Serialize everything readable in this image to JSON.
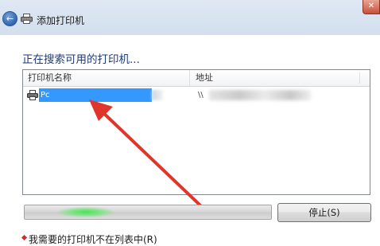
{
  "window": {
    "title": "添加打印机",
    "close_label": "✕"
  },
  "page": {
    "heading": "正在搜索可用的打印机..."
  },
  "printer_list": {
    "columns": [
      "打印机名称",
      "地址"
    ],
    "rows": [
      {
        "name": "Pc",
        "address": "\\\\"
      }
    ]
  },
  "progress": {
    "state": "indeterminate"
  },
  "buttons": {
    "stop_label": "停止(S)"
  },
  "bottom_link": {
    "text": "我需要的打印机不在列表中(R)"
  },
  "colors": {
    "selection": "#3399ff",
    "heading": "#1e3a78",
    "annotation_arrow": "#e0352b"
  },
  "icons": {
    "back": "back-arrow-icon",
    "title_printer": "printer-icon",
    "row_printer": "printer-icon",
    "close": "close-icon"
  }
}
